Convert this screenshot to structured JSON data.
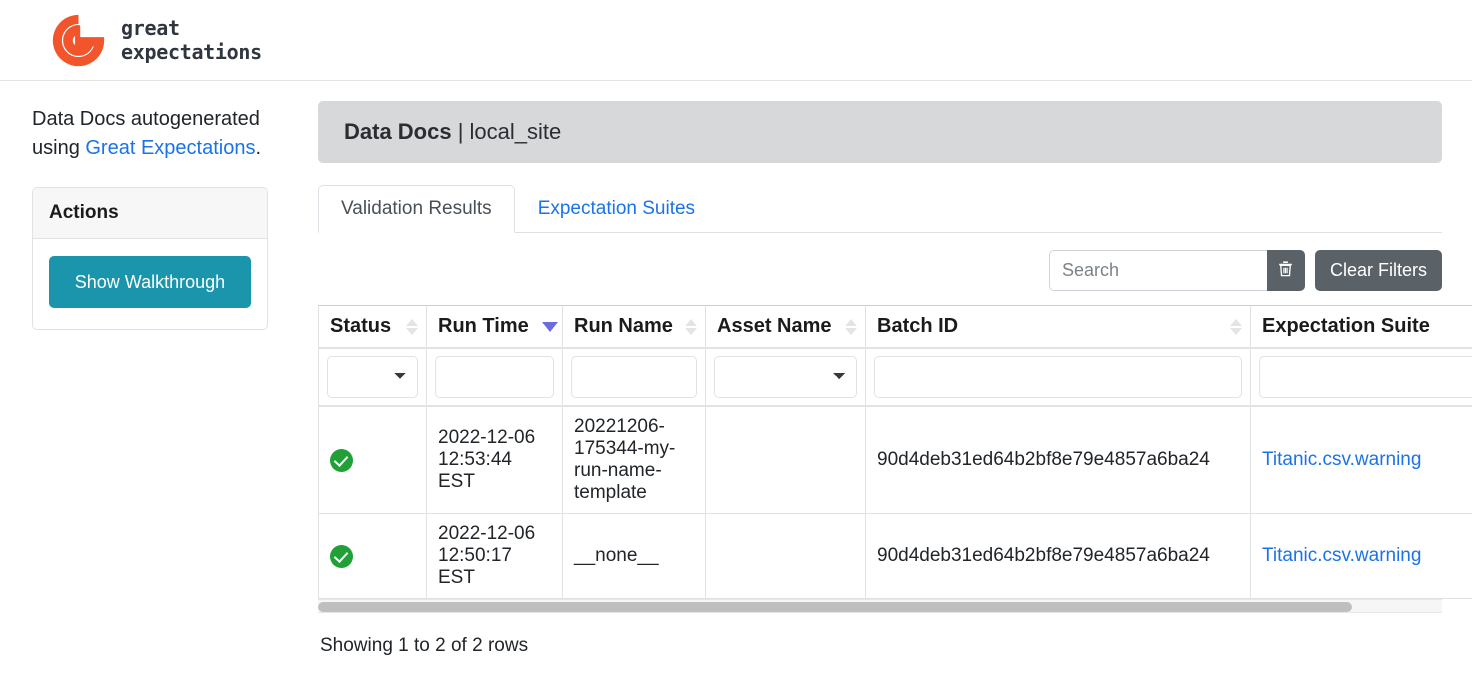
{
  "brand": {
    "line1": "great",
    "line2": "expectations",
    "logo_color": "#f2552c",
    "icon": "great-expectations-logo"
  },
  "sidebar": {
    "intro_prefix": "Data Docs autogenerated using ",
    "intro_link": "Great Expectations",
    "intro_suffix": ".",
    "actions_panel": {
      "title": "Actions",
      "walkthrough_button": "Show Walkthrough",
      "button_color": "#1b95ab"
    }
  },
  "main": {
    "banner_title": "Data Docs",
    "banner_separator": " | ",
    "banner_site": "local_site",
    "tabs": [
      {
        "label": "Validation Results",
        "active": true
      },
      {
        "label": "Expectation Suites",
        "active": false
      }
    ],
    "toolbar": {
      "search_placeholder": "Search",
      "search_value": "",
      "trash_icon": "trash-icon",
      "clear_filters_label": "Clear Filters"
    },
    "table": {
      "columns": [
        {
          "label": "Status",
          "sort": "none",
          "filter": "select"
        },
        {
          "label": "Run Time",
          "sort": "desc",
          "filter": "input"
        },
        {
          "label": "Run Name",
          "sort": "none",
          "filter": "input"
        },
        {
          "label": "Asset Name",
          "sort": "none",
          "filter": "select"
        },
        {
          "label": "Batch ID",
          "sort": "none",
          "filter": "input"
        },
        {
          "label": "Expectation Suite",
          "sort": "none",
          "filter": "input"
        }
      ],
      "filters": {
        "status": "",
        "run_time": "",
        "run_name": "",
        "asset_name": "",
        "batch_id": "",
        "expectation_suite": ""
      },
      "rows": [
        {
          "status": "success",
          "status_icon": "check-circle-icon",
          "run_time": "2022-12-06 12:53:44 EST",
          "run_name": "20221206-175344-my-run-name-template",
          "asset_name": "",
          "batch_id": "90d4deb31ed64b2bf8e79e4857a6ba24",
          "expectation_suite": "Titanic.csv.warning"
        },
        {
          "status": "success",
          "status_icon": "check-circle-icon",
          "run_time": "2022-12-06 12:50:17 EST",
          "run_name": "__none__",
          "asset_name": "",
          "batch_id": "90d4deb31ed64b2bf8e79e4857a6ba24",
          "expectation_suite": "Titanic.csv.warning"
        }
      ],
      "rows_info": "Showing 1 to 2 of 2 rows"
    }
  },
  "colors": {
    "link": "#1a73e8",
    "success": "#21a038",
    "banner_bg": "#d6d8da",
    "button_dark": "#5a6268",
    "sort_active": "#6c6ce0"
  }
}
